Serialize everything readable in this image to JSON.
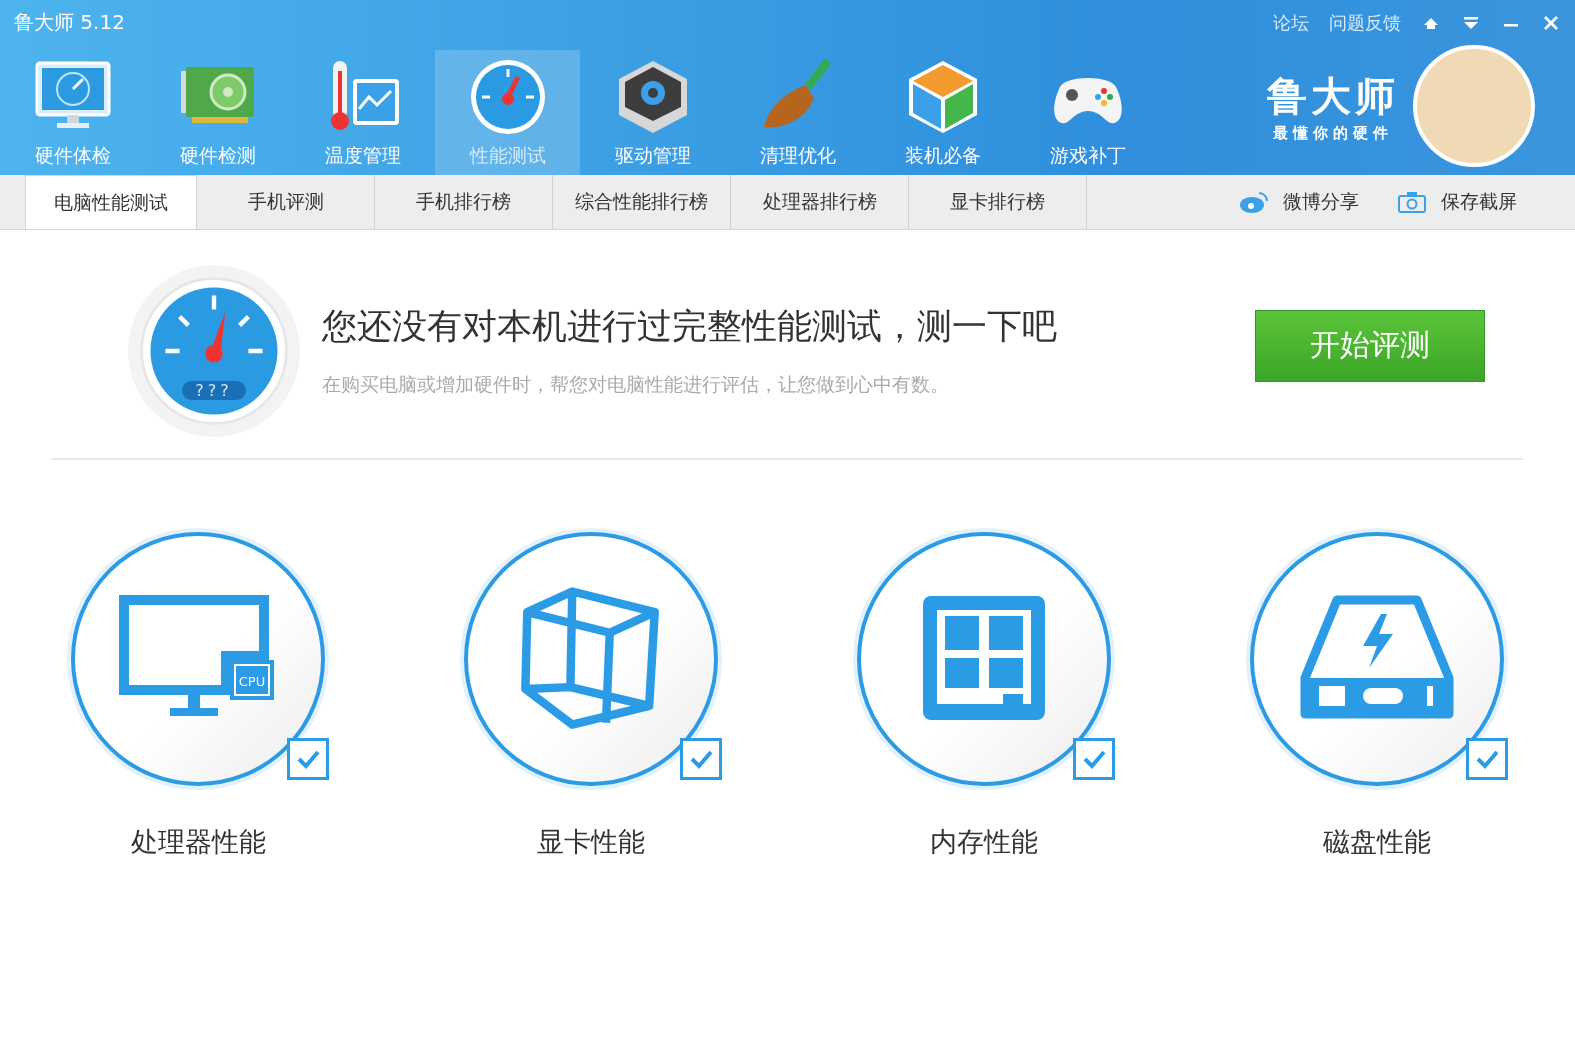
{
  "window": {
    "title": "鲁大师 5.12",
    "links": [
      "论坛",
      "问题反馈"
    ]
  },
  "nav": [
    {
      "label": "硬件体检",
      "selected": false
    },
    {
      "label": "硬件检测",
      "selected": false
    },
    {
      "label": "温度管理",
      "selected": false
    },
    {
      "label": "性能测试",
      "selected": true
    },
    {
      "label": "驱动管理",
      "selected": false
    },
    {
      "label": "清理优化",
      "selected": false
    },
    {
      "label": "装机必备",
      "selected": false
    },
    {
      "label": "游戏补丁",
      "selected": false
    }
  ],
  "brand": {
    "name": "鲁大师",
    "slogan": "最懂你的硬件"
  },
  "tabs": [
    {
      "label": "电脑性能测试",
      "selected": true
    },
    {
      "label": "手机评测",
      "selected": false
    },
    {
      "label": "手机排行榜",
      "selected": false
    },
    {
      "label": "综合性能排行榜",
      "selected": false
    },
    {
      "label": "处理器排行榜",
      "selected": false
    },
    {
      "label": "显卡排行榜",
      "selected": false
    }
  ],
  "tab_actions": [
    "微博分享",
    "保存截屏"
  ],
  "hero": {
    "gauge_reading": "???",
    "headline": "您还没有对本机进行过完整性能测试，测一下吧",
    "subtitle": "在购买电脑或增加硬件时，帮您对电脑性能进行评估，让您做到心中有数。",
    "button": "开始评测"
  },
  "tests": [
    {
      "label": "处理器性能",
      "checked": true,
      "chip_label": "CPU"
    },
    {
      "label": "显卡性能",
      "checked": true
    },
    {
      "label": "内存性能",
      "checked": true
    },
    {
      "label": "磁盘性能",
      "checked": true
    }
  ]
}
